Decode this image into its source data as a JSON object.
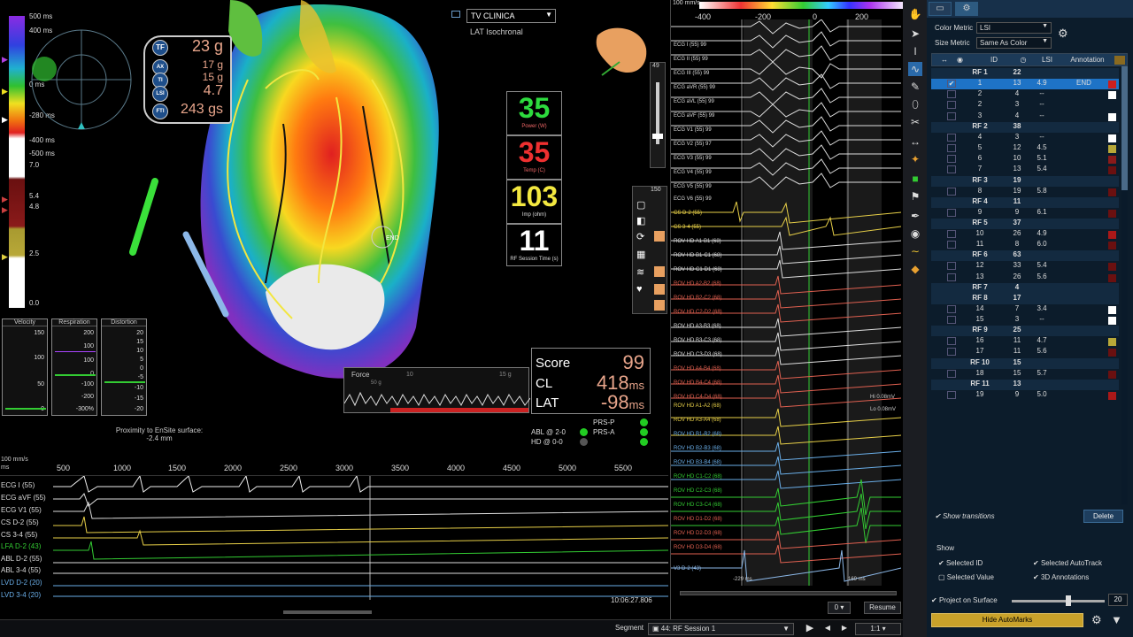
{
  "colorbar": {
    "lat_top": "500 ms",
    "lat_400": "400 ms",
    "lat_0": "0 ms",
    "lat_neg_280": "-280 ms",
    "lat_neg_400": "-400 ms",
    "lat_neg_500": "-500 ms",
    "lsi_7": "7.0",
    "lsi_5_4": "5.4",
    "lsi_4_8": "4.8",
    "lsi_2_5": "2.5",
    "lsi_0": "0.0"
  },
  "force": {
    "icon_tf": "TF",
    "icon_ax": "AX",
    "icon_ti": "TI",
    "icon_lsi": "LSI",
    "icon_fti": "FTI",
    "total": "23 g",
    "lateral": "17 g",
    "axial": "15 g",
    "lsi": "4.7",
    "fti": "243 gs"
  },
  "map": {
    "type": "TV CLINICA",
    "label": "LAT Isochronal",
    "proximity_label": "Proximity to EnSite surface:",
    "proximity_value": "-2.4 mm",
    "point_label": "END"
  },
  "metrics": [
    {
      "value": "35",
      "label": "Power (W)",
      "color": "#2ddb3e"
    },
    {
      "value": "35",
      "label": "Temp (C)",
      "color": "#ee3030"
    },
    {
      "value": "103",
      "label": "Imp (ohm)",
      "color": "#f3e840"
    },
    {
      "value": "11",
      "label": "RF Session Time (s)",
      "color": "#ffffff"
    }
  ],
  "score": {
    "score_label": "Score",
    "score_value": "99",
    "cl_label": "CL",
    "cl_value": "418",
    "cl_unit": "ms",
    "lat_label": "LAT",
    "lat_value": "-98",
    "lat_unit": "ms"
  },
  "forcegraph": {
    "title": "Force",
    "t1": "10",
    "t2": "15 g",
    "t3": "50 g"
  },
  "minigraphs": [
    {
      "title": "Velocity",
      "ticks": [
        "150",
        "100",
        "50",
        "0"
      ]
    },
    {
      "title": "Respiration",
      "ticks": [
        "200",
        "100",
        "0",
        "-100",
        "-200",
        "-300%"
      ]
    },
    {
      "title": "Distortion",
      "ticks": [
        "20",
        "15",
        "10",
        "5",
        "0",
        "-5",
        "-10",
        "-15",
        "-20"
      ]
    }
  ],
  "abl": {
    "abl_label": "ABL @ 2-0",
    "hd_label": "HD @ 0-0",
    "prs_p": "PRS-P",
    "prs_a": "PRS-A"
  },
  "bottom": {
    "scale": "100 mm/s",
    "unit": "ms",
    "ticks": [
      "500",
      "1000",
      "1500",
      "2000",
      "2500",
      "3000",
      "3500",
      "4000",
      "4500",
      "5000",
      "5500"
    ],
    "labels": [
      "ECG I (55)",
      "ECG aVF (55)",
      "ECG V1 (55)",
      "CS D-2 (55)",
      "CS 3-4 (55)",
      "LFA D-2 (43)",
      "ABL D-2 (55)",
      "ABL 3-4 (55)",
      "LVD D-2 (20)",
      "LVD 3-4 (20)"
    ],
    "timestamp": "10:06:27.806"
  },
  "right_traces": {
    "scale": "100 mm/s",
    "zoom": "49",
    "ticks": [
      "-400",
      "-200",
      "0",
      "200"
    ],
    "num_150": "150",
    "labels": [
      "ECG I (55) 99",
      "ECG II (55) 99",
      "ECG III (55) 99",
      "ECG aVR (55) 99",
      "ECG aVL (55) 99",
      "ECG aVF (55) 99",
      "ECG V1 (55) 99",
      "ECG V2 (55) 97",
      "ECG V3 (55) 99",
      "ECG V4 (55) 99",
      "ECG V5 (55) 99",
      "ECG V6 (55) 99",
      "CS D-2 (55)",
      "CS 3-4 (55)",
      "ROV HD A1-B1 (68)",
      "ROV HD B1-C1 (68)",
      "ROV HD C1-D1 (68)",
      "ROV HD A2-B2 (68)",
      "ROV HD B2-C2 (68)",
      "ROV HD C2-D2 (68)",
      "ROV HD A3-B3 (68)",
      "ROV HD B3-C3 (68)",
      "ROV HD C3-D3 (68)",
      "ROV HD A4-B4 (68)",
      "ROV HD B4-C4 (68)",
      "ROV HD C4-D4 (68)",
      "ROV HD A1-A2 (68)",
      "ROV HD A3-A4 (68)",
      "ROV HD B1-B2 (68)",
      "ROV HD B2-B3 (68)",
      "ROV HD B3-B4 (68)",
      "ROV HD C1-C2 (68)",
      "ROV HD C2-C3 (68)",
      "ROV HD C3-C4 (68)",
      "ROV HD D1-D2 (68)",
      "ROV HD D2-D3 (68)",
      "ROV HD D3-D4 (68)",
      "V3 D-2 (43)"
    ],
    "hi": "Hi 0.08mV",
    "lo": "Lo 0.08mV",
    "m_left": "-229 ms",
    "m_right": "169 ms"
  },
  "panel": {
    "color_metric_label": "Color Metric",
    "color_metric": "LSI",
    "size_metric_label": "Size Metric",
    "size_metric": "Same As Color",
    "col_id": "ID",
    "col_lsi": "LSI",
    "col_annotation": "Annotation",
    "show_transitions": "Show transitions",
    "delete": "Delete",
    "show": "Show",
    "selected_id": "Selected ID",
    "selected_value": "Selected Value",
    "selected_autotrack": "Selected AutoTrack",
    "annotations_3d": "3D Annotations",
    "project_on_surface": "Project on Surface",
    "project_value": "20",
    "hide_automarks": "Hide AutoMarks"
  },
  "rows": [
    {
      "g": 1,
      "id": "RF 1",
      "t": "22"
    },
    {
      "id": "1",
      "t": "13",
      "lsi": "4.9",
      "ann": "END",
      "sw": "#cc1e1e",
      "sel": 1
    },
    {
      "id": "2",
      "t": "4",
      "lsi": "--",
      "sw": "#ffffff"
    },
    {
      "id": "2",
      "t": "3",
      "lsi": "--"
    },
    {
      "id": "3",
      "t": "4",
      "lsi": "--",
      "sw": "#ffffff"
    },
    {
      "g": 1,
      "id": "RF 2",
      "t": "38"
    },
    {
      "id": "4",
      "t": "3",
      "lsi": "--",
      "sw": "#ffffff"
    },
    {
      "id": "5",
      "t": "12",
      "lsi": "4.5",
      "sw": "#b8a838"
    },
    {
      "id": "6",
      "t": "10",
      "lsi": "5.1",
      "sw": "#8a1a1a"
    },
    {
      "id": "7",
      "t": "13",
      "lsi": "5.4",
      "sw": "#6a1010"
    },
    {
      "g": 1,
      "id": "RF 3",
      "t": "19"
    },
    {
      "id": "8",
      "t": "19",
      "lsi": "5.8",
      "sw": "#6a1010"
    },
    {
      "g": 1,
      "id": "RF 4",
      "t": "11"
    },
    {
      "id": "9",
      "t": "9",
      "lsi": "6.1",
      "sw": "#6a1010"
    },
    {
      "g": 1,
      "id": "RF 5",
      "t": "37"
    },
    {
      "id": "10",
      "t": "26",
      "lsi": "4.9",
      "sw": "#aa1818"
    },
    {
      "id": "11",
      "t": "8",
      "lsi": "6.0",
      "sw": "#6a1010"
    },
    {
      "g": 1,
      "id": "RF 6",
      "t": "63"
    },
    {
      "id": "12",
      "t": "33",
      "lsi": "5.4",
      "sw": "#6a1010"
    },
    {
      "id": "13",
      "t": "26",
      "lsi": "5.6",
      "sw": "#6a1010"
    },
    {
      "g": 1,
      "id": "RF 7",
      "t": "4"
    },
    {
      "g": 1,
      "id": "RF 8",
      "t": "17"
    },
    {
      "id": "14",
      "t": "7",
      "lsi": "3.4",
      "sw": "#ffffff"
    },
    {
      "id": "15",
      "t": "3",
      "lsi": "--",
      "sw": "#ffffff"
    },
    {
      "g": 1,
      "id": "RF 9",
      "t": "25"
    },
    {
      "id": "16",
      "t": "11",
      "lsi": "4.7",
      "sw": "#b8a838"
    },
    {
      "id": "17",
      "t": "11",
      "lsi": "5.6",
      "sw": "#6a1010"
    },
    {
      "g": 1,
      "id": "RF 10",
      "t": "15"
    },
    {
      "id": "18",
      "t": "15",
      "lsi": "5.7",
      "sw": "#6a1010"
    },
    {
      "g": 1,
      "id": "RF 11",
      "t": "13"
    },
    {
      "id": "19",
      "t": "9",
      "lsi": "5.0",
      "sw": "#aa1818"
    }
  ],
  "status": {
    "counter": "0",
    "resume": "Resume",
    "segment_label": "Segment",
    "segment_value": "44: RF Session 1",
    "speed": "1:1"
  }
}
